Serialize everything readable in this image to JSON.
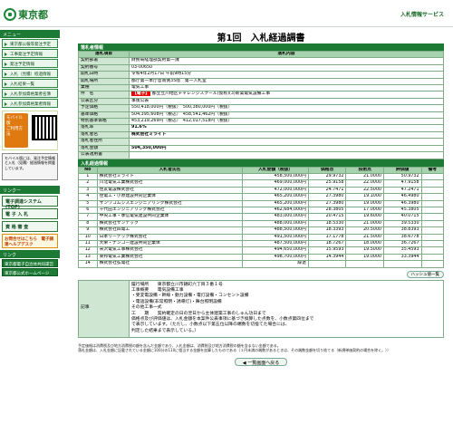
{
  "header": {
    "logo": "東京都",
    "service": "入札情報サービス"
  },
  "sidebar": {
    "menu_title": "メニュー",
    "items": [
      "東京都公報等発注予定",
      "工事発注予定情報",
      "発注予定情報",
      "入札（見積）経過情報",
      "入札結果一覧",
      "入札参加資格業者名簿",
      "入札参加資格業者情報"
    ],
    "mobile_label": "モバイル版",
    "mobile_sub": "ご利用方法",
    "mobile_note": "モバイル版には、発注予定情報と入札（見積）経過情報を掲載しています。",
    "links_title": "リンクー",
    "bigbtn1": "電子調達システム(TOP)",
    "bigbtn2": "電 子 入 札",
    "bigbtn3": "資 格 審 査",
    "orange_btn": "お問合せはこちら　電子調達ヘルプデスク",
    "links2_title": "リンク",
    "link_a": "東京都電子自治体共同運営",
    "link_b": "東京都公式ホームページ"
  },
  "page_title": "第1回　入札経過調書",
  "info": {
    "section": "落札者情報",
    "col1": "落札項目",
    "col2": "落札内容",
    "rows": [
      {
        "l": "契約部署",
        "v": "財務局経理部契約第一課"
      },
      {
        "l": "契約番号",
        "v": "03-00650"
      },
      {
        "l": "開札日時",
        "v": "令和4年2月17日 午前9時15分"
      },
      {
        "l": "開札場所",
        "v": "都庁第一本庁舎南側35階　第一入札室"
      },
      {
        "l": "業種",
        "v": "電気工事"
      },
      {
        "l": "件　名",
        "badge": "【電子】",
        "v": "都立立川地区チャレンジスクール(仮称)(3)新築電気設備工事"
      },
      {
        "l": "公表区分",
        "v": "事後公表"
      },
      {
        "l": "予定価格",
        "v": "550,418,000円（税抜）　500,380,000円（税抜）"
      },
      {
        "l": "基準価格",
        "v": "504,395,608円（税込）　458,541,462円（税抜）"
      },
      {
        "l": "特別基準価格",
        "v": "453,219,269円（税込）　412,017,518円（税抜）"
      },
      {
        "l": "落札率",
        "v": "91.6%"
      },
      {
        "l": "落札者名",
        "v": "株式会社ミライト"
      },
      {
        "l": "落札者住所",
        "v": ""
      },
      {
        "l": "落札金額",
        "v": "504,350,000円"
      },
      {
        "l": "公表適用書",
        "v": ""
      }
    ]
  },
  "bids": {
    "section": "入札経過情報",
    "headers": [
      "No",
      "入札者氏名",
      "入札金額（税抜）",
      "価格点",
      "技術点",
      "評価値",
      "備考"
    ],
    "rows": [
      [
        "1",
        "株式会社ミライト",
        "458,500,000円",
        "29.9732",
        "21.0000",
        "50.9732",
        ""
      ],
      [
        "2",
        "川北電気工業株式会社",
        "469,000,000円",
        "25.9158",
        "22.0000",
        "47.9158",
        ""
      ],
      [
        "3",
        "住友電設株式会社",
        "472,000,000円",
        "24.7471",
        "22.5000",
        "47.2471",
        ""
      ],
      [
        "4",
        "住電工・小原建設共同企業体",
        "465,200,000円",
        "27.3980",
        "19.1000",
        "46.4980",
        ""
      ],
      [
        "5",
        "サンワコムシスエンジニアリング株式会社",
        "465,200,000円",
        "27.3980",
        "19.0000",
        "46.3980",
        ""
      ],
      [
        "6",
        "千代田エンジニアリング株式会社",
        "462,684,000円",
        "28.3805",
        "17.0000",
        "45.3805",
        ""
      ],
      [
        "7",
        "中央工事・季信電気建設共同企業体",
        "483,000,000円",
        "20.4715",
        "19.6000",
        "40.0715",
        ""
      ],
      [
        "8",
        "株式会社サンテック",
        "488,000,000円",
        "18.5330",
        "21.0000",
        "39.5330",
        ""
      ],
      [
        "9",
        "株式会社四電工",
        "488,500,000円",
        "18.3393",
        "20.5000",
        "38.8393",
        ""
      ],
      [
        "10",
        "日本リーテック株式会社",
        "491,500,000円",
        "17.1778",
        "21.5000",
        "38.6778",
        ""
      ],
      [
        "11",
        "大栄・ナンコー建設共同企業体",
        "487,500,000円",
        "18.7267",
        "18.0000",
        "36.7267",
        ""
      ],
      [
        "12",
        "米沢電気工事株式会社",
        "494,650,000円",
        "15.9593",
        "19.5000",
        "35.4593",
        ""
      ],
      [
        "13",
        "東邦電気工業株式会社",
        "498,700,000円",
        "14.3944",
        "19.0000",
        "33.3944",
        ""
      ],
      [
        "14",
        "株式会社弘電社",
        "辞退",
        "",
        "",
        "",
        ""
      ]
    ]
  },
  "history_btn": "ハッシュ値一覧",
  "remarks": {
    "label": "記事",
    "lines": [
      "履行場所　　東京都立川市錦町六丁目３番１号",
      "工事概要　　電気設備工事",
      "・受変電設備・幹線・動力設備・電灯設備・コンセント設備",
      "・電話設備(非常照明・誘導灯)・舞台照明設備",
      "その他工事一式",
      "工　　期　　契約確定の日の翌日から主体建築工事のしゅん功日まで",
      "価格点及び評価値は、入札金額を本案件公表事項に基づき換算した点数を、小数点第四位まで",
      "で表示しています。（ただし、小数点以下第五位以降の端数を切捨てた場合には、",
      "判定した結果まで表示している。）"
    ]
  },
  "footnote1": "予定価格は消費税及び地方消費税の額を含んだ金額であり、入札金額は、消費税及び地方消費税の額を含まない金額である。",
  "footnote2": "落札金額は、入札金額に記載されている金額に100分の110に相当する金額を加算したものである（１円未満の端数があるときは、その端数金額を切り捨てる（新規単価契約の場合を除く。））",
  "back_btn": "◀ 一覧画面へ戻る"
}
